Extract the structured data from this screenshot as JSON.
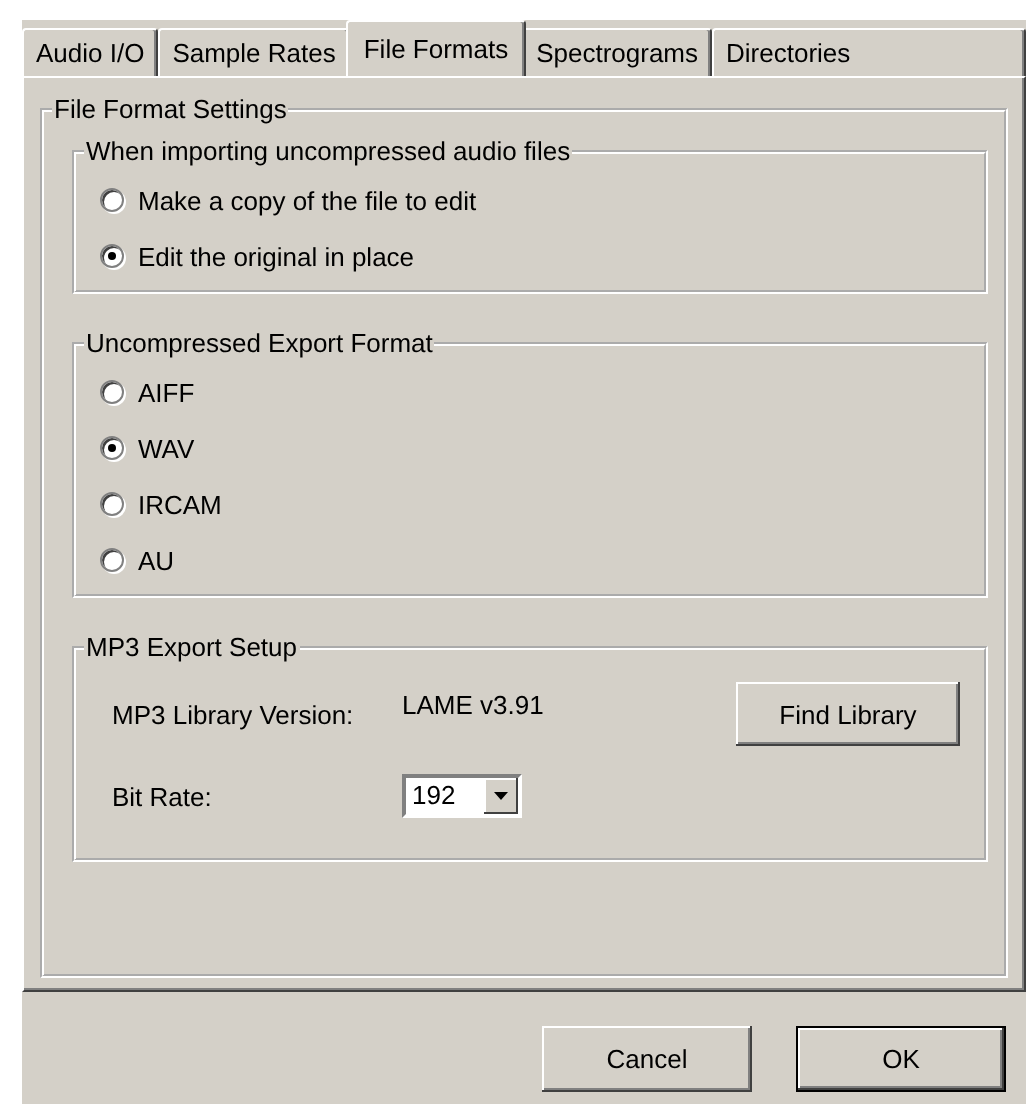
{
  "tabs": [
    {
      "label": "Audio I/O",
      "selected": false
    },
    {
      "label": "Sample Rates",
      "selected": false
    },
    {
      "label": "File Formats",
      "selected": true
    },
    {
      "label": "Spectrograms",
      "selected": false
    },
    {
      "label": "Directories",
      "selected": false
    }
  ],
  "settings": {
    "title": "File Format Settings",
    "import_mode": {
      "title": "When importing uncompressed audio files",
      "options": [
        {
          "label": "Make a copy of the file to edit",
          "selected": false
        },
        {
          "label": "Edit the original in place",
          "selected": true
        }
      ]
    },
    "export_format": {
      "title": "Uncompressed Export Format",
      "options": [
        {
          "label": "AIFF",
          "selected": false
        },
        {
          "label": "WAV",
          "selected": true
        },
        {
          "label": "IRCAM",
          "selected": false
        },
        {
          "label": "AU",
          "selected": false
        }
      ]
    },
    "mp3": {
      "title": "MP3 Export Setup",
      "library_version_label": "MP3 Library Version:",
      "library_version": "LAME v3.91",
      "find_button": "Find Library",
      "bit_rate_label": "Bit Rate:",
      "bit_rate": "192"
    }
  },
  "buttons": [
    {
      "label": "Cancel",
      "default": false
    },
    {
      "label": "OK",
      "default": true
    }
  ]
}
